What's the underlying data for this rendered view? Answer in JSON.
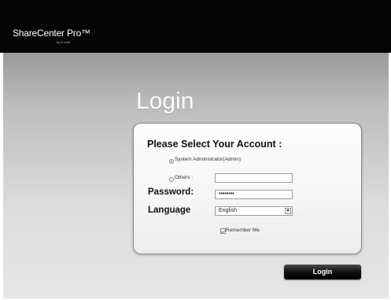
{
  "header": {
    "brand": "ShareCenter Pro™",
    "brand_sub": "by D-Link"
  },
  "login": {
    "title": "Login",
    "panel_title": "Please Select Your Account :",
    "options": {
      "admin": "System Administrator(Admin)",
      "others": "Others :"
    },
    "fields": {
      "password_label": "Password:",
      "password_value": "••••••••",
      "language_label": "Language",
      "language_value": "English"
    },
    "remember_me": "Remember Me",
    "login_button": "Login"
  },
  "colors": {
    "header_bg": "#050505",
    "accent": "#4a8ab8"
  }
}
